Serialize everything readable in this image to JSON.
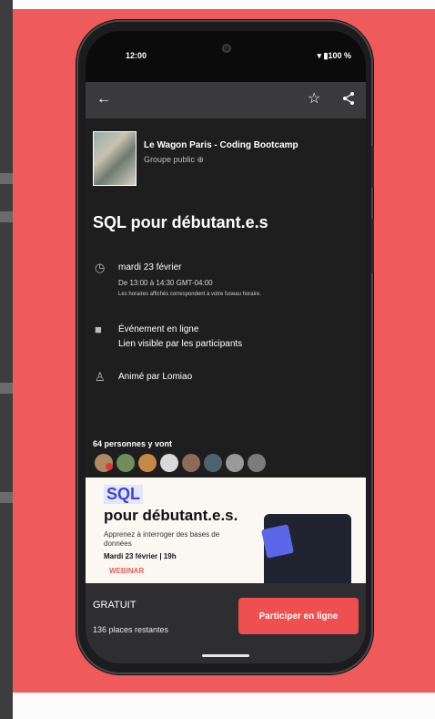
{
  "status_bar": {
    "time": "12:00",
    "battery": "▾ ▮100 %"
  },
  "app_bar": {
    "back_icon": "arrow-left",
    "star_icon": "star-outline",
    "share_icon": "share"
  },
  "group": {
    "name": "Le Wagon Paris - Coding Bootcamp",
    "type": "Groupe public ⊕"
  },
  "event": {
    "title": "SQL pour débutant.e.s",
    "date": "mardi 23 février",
    "time": "De 13:00 à 14:30 GMT-04:00",
    "timezone_note": "Les horaires affichés correspondent à votre fuseau horaire.",
    "location_title": "Événement en ligne",
    "location_sub": "Lien visible par les participants",
    "host": "Animé par Lomiao",
    "attendees": "64 personnes y vont"
  },
  "banner": {
    "sql": "SQL",
    "title": "pour débutant.e.s.",
    "subtitle": "Apprenez à interroger des bases de données",
    "date": "Mardi 23 février | 19h",
    "tag": "WEBINAR"
  },
  "footer": {
    "price": "GRATUIT",
    "places": "136 places restantes",
    "cta": "Participer en ligne"
  },
  "colors": {
    "background": "#ef5a5a",
    "cta": "#ef4f4f",
    "screen": "#1e1e1e",
    "appbar": "#3a3a3c"
  }
}
